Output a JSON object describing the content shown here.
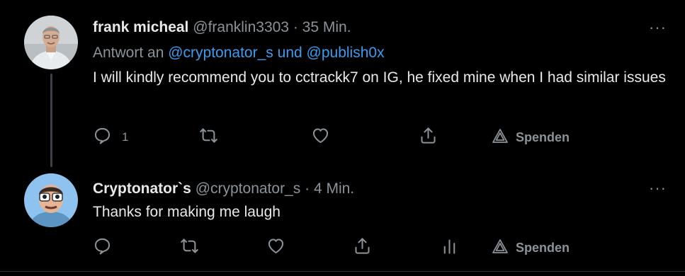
{
  "tweets": [
    {
      "name": "frank micheal",
      "handle": "@franklin3303",
      "sep": "·",
      "time": "35 Min.",
      "reply_prefix": "Antwort an",
      "mention1": "@cryptonator_s",
      "reply_and": "und",
      "mention2": "@publish0x",
      "text": "I will kindly recommend you to cctrackk7 on IG, he fixed mine when I had similar issues",
      "reply_count": "1",
      "more": "···",
      "donate_label": "Spenden"
    },
    {
      "name": "Cryptonator`s",
      "handle": "@cryptonator_s",
      "sep": "·",
      "time": "4 Min.",
      "text": "Thanks for making me laugh",
      "more": "···",
      "donate_label": "Spenden"
    }
  ],
  "icons": {
    "reply": "reply-icon",
    "retweet": "retweet-icon",
    "like": "heart-icon",
    "share": "share-icon",
    "analytics": "analytics-icon",
    "donate": "donate-icon"
  },
  "colors": {
    "background": "#000000",
    "text": "#e7e9ea",
    "secondary": "#8b9298",
    "link": "#3b9cf0",
    "thread_line": "#3d4247"
  }
}
